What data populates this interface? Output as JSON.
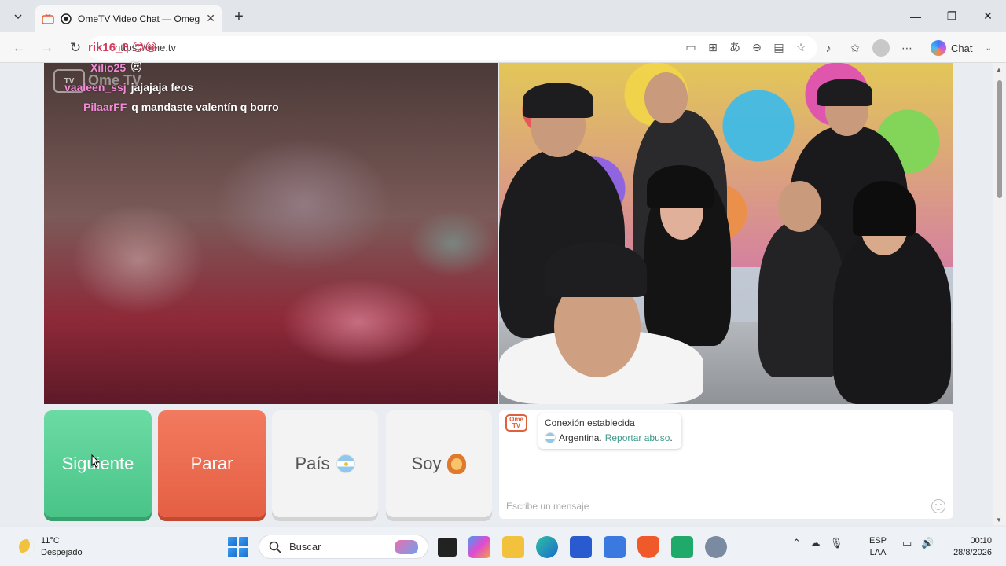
{
  "browser": {
    "tab_title": "OmeTV Video Chat — Omegle",
    "address": "https://ome.tv",
    "chat_label": "Chat"
  },
  "stream_overlay": {
    "streamer_name": "rik16_8 😍😂"
  },
  "video_left": {
    "logo_text": "Ome TV",
    "comments": [
      {
        "user": "Xilio25",
        "text": "😻"
      },
      {
        "user": "vaaleen_ssj",
        "text": "jajajaja feos"
      },
      {
        "user": "PilaarFF",
        "text": "q mandaste valentín q borro"
      }
    ]
  },
  "controls": {
    "next_label": "Siguiente",
    "stop_label": "Parar",
    "country_label": "País",
    "me_label": "Soy"
  },
  "chat": {
    "logo_text": "Ome TV",
    "status": "Conexión establecida",
    "country": "Argentina.",
    "report_link": "Reportar abuso",
    "report_suffix": ".",
    "input_placeholder": "Escribe un mensaje"
  },
  "taskbar": {
    "temperature": "11°C",
    "weather": "Despejado",
    "search_label": "Buscar",
    "lang_line1": "ESP",
    "lang_line2": "LAA",
    "time": "00:10",
    "date": "28/8/2026"
  },
  "colors": {
    "next_button": "#49c487",
    "stop_button": "#e55f44",
    "comment_user": "#f28ad6"
  }
}
